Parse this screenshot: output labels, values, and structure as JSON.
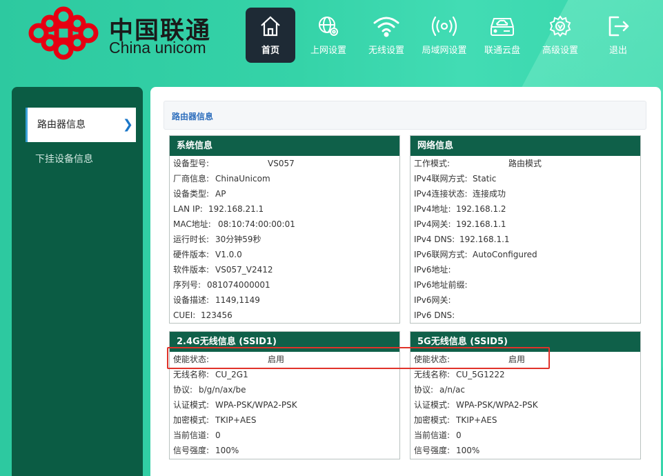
{
  "brand": {
    "name_cn": "中国联通",
    "name_en": "China unicom",
    "logo_color": "#e60012"
  },
  "nav": {
    "items": [
      {
        "label": "首页",
        "icon": "home-icon",
        "active": true
      },
      {
        "label": "上网设置",
        "icon": "globe-gear-icon",
        "active": false
      },
      {
        "label": "无线设置",
        "icon": "wifi-icon",
        "active": false
      },
      {
        "label": "局域网设置",
        "icon": "broadcast-icon",
        "active": false
      },
      {
        "label": "联通云盘",
        "icon": "cloud-drive-icon",
        "active": false
      },
      {
        "label": "高级设置",
        "icon": "gear-icon",
        "active": false
      },
      {
        "label": "退出",
        "icon": "logout-icon",
        "active": false
      }
    ]
  },
  "sidebar": {
    "items": [
      {
        "label": "路由器信息",
        "active": true
      },
      {
        "label": "下挂设备信息",
        "active": false
      }
    ]
  },
  "breadcrumb": "路由器信息",
  "panels": {
    "system": {
      "title": "系统信息",
      "rows": [
        {
          "k": "设备型号:",
          "v": "VS057"
        },
        {
          "k": "厂商信息:",
          "v": "ChinaUnicom"
        },
        {
          "k": "设备类型:",
          "v": "AP"
        },
        {
          "k": "LAN IP:",
          "v": "192.168.21.1"
        },
        {
          "k": "MAC地址:",
          "v": "08:10:74:00:00:01"
        },
        {
          "k": "运行时长:",
          "v": "30分钟59秒"
        },
        {
          "k": "硬件版本:",
          "v": "V1.0.0"
        },
        {
          "k": "软件版本:",
          "v": "VS057_V2412"
        },
        {
          "k": "序列号:",
          "v": "081074000001"
        },
        {
          "k": "设备描述:",
          "v": "1149,1149"
        },
        {
          "k": "CUEI:",
          "v": "123456"
        }
      ]
    },
    "network": {
      "title": "网络信息",
      "rows": [
        {
          "k": "工作模式:",
          "v": "路由模式"
        },
        {
          "k": "IPv4联网方式:",
          "v": "Static"
        },
        {
          "k": "IPv4连接状态:",
          "v": "连接成功"
        },
        {
          "k": "IPv4地址:",
          "v": "192.168.1.2"
        },
        {
          "k": "IPv4网关:",
          "v": "192.168.1.1"
        },
        {
          "k": "IPv4 DNS:",
          "v": "192.168.1.1"
        },
        {
          "k": "IPv6联网方式:",
          "v": "AutoConfigured"
        },
        {
          "k": "IPv6地址:",
          "v": ""
        },
        {
          "k": "IPv6地址前缀:",
          "v": ""
        },
        {
          "k": "IPv6网关:",
          "v": ""
        },
        {
          "k": "IPv6 DNS:",
          "v": ""
        }
      ]
    },
    "wifi24": {
      "title": "2.4G无线信息 (SSID1)",
      "rows": [
        {
          "k": "使能状态:",
          "v": "启用"
        },
        {
          "k": "无线名称:",
          "v": "CU_2G1"
        },
        {
          "k": "协议:",
          "v": "b/g/n/ax/be"
        },
        {
          "k": "认证模式:",
          "v": "WPA-PSK/WPA2-PSK"
        },
        {
          "k": "加密模式:",
          "v": "TKIP+AES"
        },
        {
          "k": "当前信道:",
          "v": "0"
        },
        {
          "k": "信号强度:",
          "v": "100%"
        }
      ]
    },
    "wifi5": {
      "title": "5G无线信息 (SSID5)",
      "rows": [
        {
          "k": "使能状态:",
          "v": "启用"
        },
        {
          "k": "无线名称:",
          "v": "CU_5G1222"
        },
        {
          "k": "协议:",
          "v": "a/n/ac"
        },
        {
          "k": "认证模式:",
          "v": "WPA-PSK/WPA2-PSK"
        },
        {
          "k": "加密模式:",
          "v": "TKIP+AES"
        },
        {
          "k": "当前信道:",
          "v": "0"
        },
        {
          "k": "信号强度:",
          "v": "100%"
        }
      ]
    }
  },
  "colors": {
    "header_bg": "#35d3a8",
    "sidebar_bg": "#0b5c44",
    "panel_head": "#0f6049",
    "nav_active": "#1e2a35",
    "highlight": "#e0322a"
  }
}
